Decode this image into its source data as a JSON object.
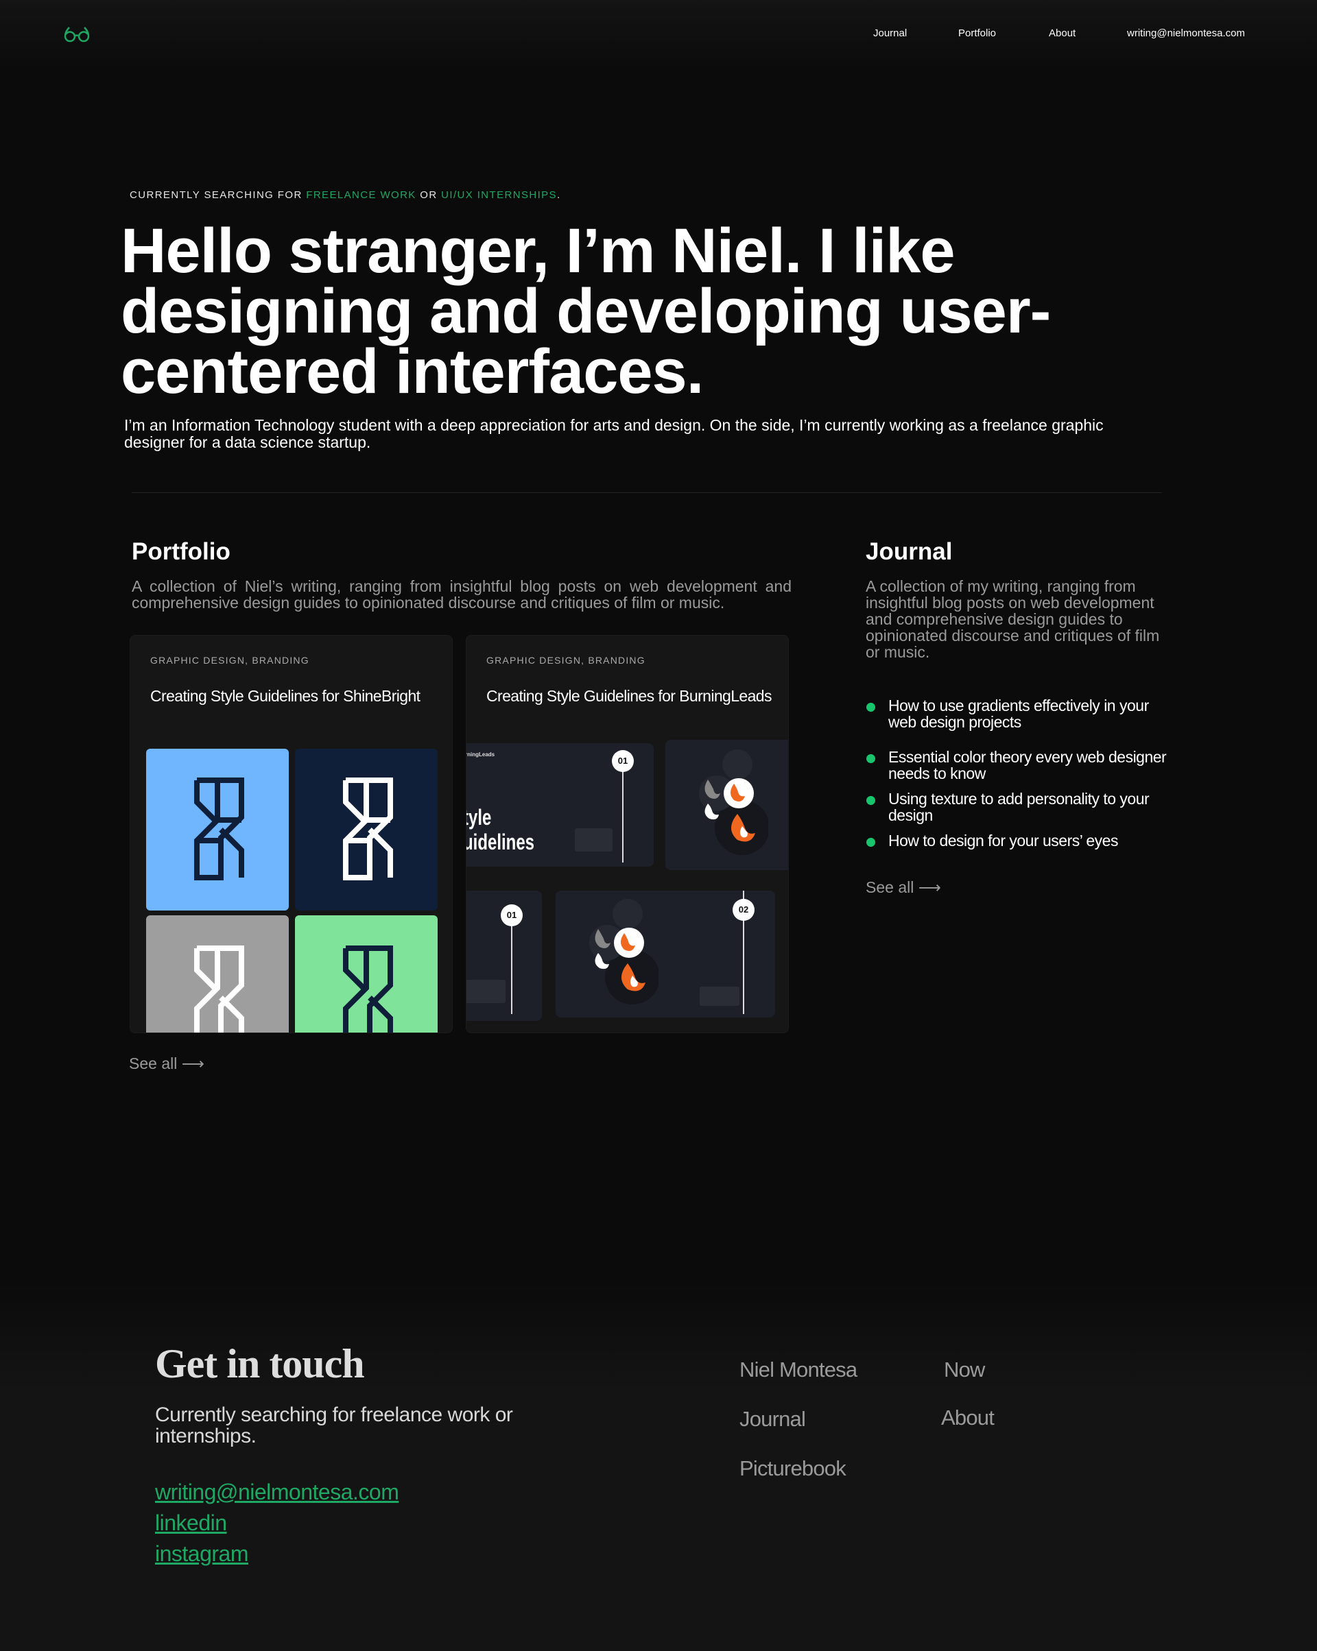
{
  "colors": {
    "accent": "#1fa864",
    "bullet": "#18c46c",
    "background": "#0b0b0b",
    "card": "#161616"
  },
  "header": {
    "logo": "glasses-logo-icon",
    "nav": [
      "Journal",
      "Portfolio",
      "About",
      "writing@nielmontesa.com"
    ]
  },
  "hero": {
    "eyebrow_prefix": "CURRENTLY SEARCHING FOR ",
    "eyebrow_hl1": "FREELANCE WORK",
    "eyebrow_mid": " OR ",
    "eyebrow_hl2": "UI/UX INTERNSHIPS",
    "eyebrow_end": ".",
    "title": "Hello stranger, I’m Niel. I like designing and developing user-centered interfaces.",
    "subtitle": "I’m an Information Technology student with a deep appreciation for arts and design. On the side, I’m currently working as a freelance graphic designer for a data science startup."
  },
  "portfolio": {
    "title": "Portfolio",
    "description": "A collection of Niel’s writing, ranging from insightful blog posts on web development and comprehensive design guides to opinionated discourse and critiques of film or music.",
    "cards": [
      {
        "tag": "GRAPHIC DESIGN, BRANDING",
        "title": "Creating Style Guidelines for ShineBright"
      },
      {
        "tag": "GRAPHIC DESIGN, BRANDING",
        "title": "Creating Style Guidelines for BurningLeads"
      }
    ],
    "slides": {
      "brand": "rningLeads",
      "heading_1": "tyle",
      "heading_2": "uidelines",
      "step_1": "01",
      "step_2": "02"
    },
    "see_all": "See all",
    "arrow": "⟶"
  },
  "journal": {
    "title": "Journal",
    "description": "A collection of my writing, ranging from insightful blog posts on web development and comprehensive design guides to opinionated discourse and critiques of film or music.",
    "items": [
      "How to use gradients effectively in your web design projects",
      "Essential color theory every web designer needs to know",
      "Using texture to add personality to your design",
      "How to design for your users’ eyes"
    ],
    "see_all": "See all",
    "arrow": "⟶"
  },
  "footer": {
    "title": "Get in touch",
    "subtitle": "Currently searching for freelance work or internships.",
    "links": [
      "writing@nielmontesa.com",
      "linkedin",
      "instagram"
    ],
    "nav": [
      "Niel Montesa",
      "Now",
      "Journal",
      "About",
      "Picturebook"
    ]
  }
}
